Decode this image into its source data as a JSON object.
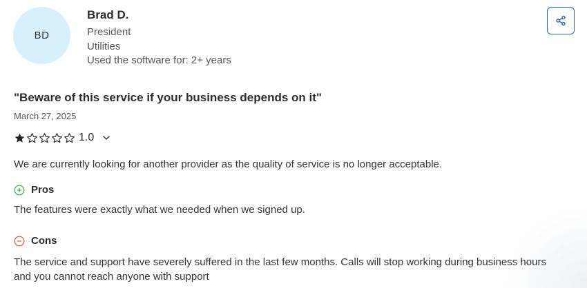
{
  "reviewer": {
    "initials": "BD",
    "name": "Brad D.",
    "title": "President",
    "industry": "Utilities",
    "usage": "Used the software for: 2+ years"
  },
  "review": {
    "title": "\"Beware of this service if your business depends on it\"",
    "date": "March 27, 2025",
    "rating": "1.0",
    "rating_stars": 1,
    "rating_max": 5,
    "summary": "We are currently looking for another provider as the quality of service is no longer acceptable.",
    "pros_label": "Pros",
    "pros_text": "The features were exactly what we needed when we signed up.",
    "cons_label": "Cons",
    "cons_text": "The service and support have severely suffered in the last few months. Calls will stop working during business hours and you cannot reach anyone with support"
  },
  "icons": {
    "share": "share-icon",
    "star_filled": "star-filled-icon",
    "star_empty": "star-outline-icon",
    "chevron": "chevron-down-icon",
    "pros": "plus-circle-icon",
    "cons": "minus-circle-icon"
  },
  "colors": {
    "avatar_bg": "#d8f0fb",
    "share_border": "#2b5fa8",
    "pros_green": "#3aa655",
    "cons_red": "#d9534f"
  }
}
